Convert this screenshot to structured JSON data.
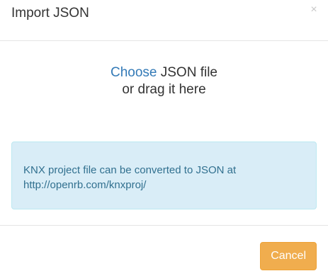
{
  "dialog": {
    "title": "Import JSON",
    "close_label": "×"
  },
  "dropzone": {
    "choose_label": "Choose",
    "file_text": " JSON file",
    "drag_text": "or drag it here"
  },
  "info": {
    "message": "KNX project file can be converted to JSON at",
    "link_text": "http://openrb.com/knxproj/"
  },
  "footer": {
    "cancel_label": "Cancel"
  },
  "colors": {
    "link": "#337ab7",
    "info_background": "#d9edf7",
    "info_text": "#31708f",
    "warning_button": "#f0ad4e"
  }
}
